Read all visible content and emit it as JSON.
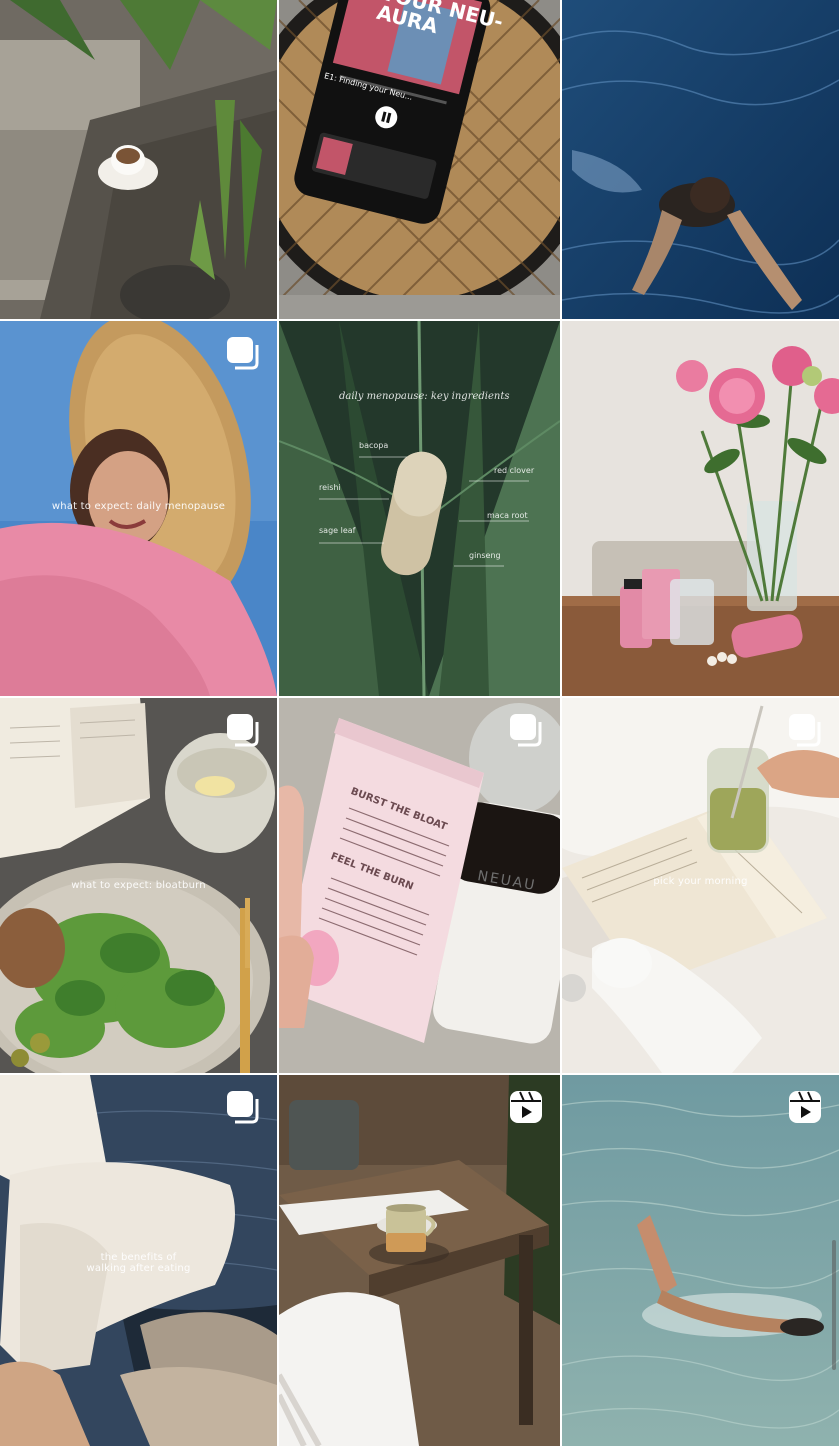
{
  "grid": {
    "posts": [
      {
        "id": "coffee",
        "caption": ""
      },
      {
        "id": "podcast",
        "caption": "",
        "phone_title": "YOUR NEU-AURA",
        "episode_title": "E1: Finding your Neu..."
      },
      {
        "id": "swimmer",
        "caption": ""
      },
      {
        "id": "straw-hat",
        "caption": "what to expect: daily menopause"
      },
      {
        "id": "capsule",
        "caption": "",
        "title_text": "daily menopause: key ingredients",
        "ingredients": [
          "bacopa",
          "red clover",
          "reishi",
          "maca root",
          "sage leaf",
          "ginseng"
        ]
      },
      {
        "id": "peonies",
        "caption": ""
      },
      {
        "id": "salad",
        "caption": "what to expect: bloatburn"
      },
      {
        "id": "bloat-box",
        "caption": "",
        "box_heading_1": "BURST THE BLOAT",
        "box_heading_2": "FEEL THE BURN",
        "bottle_label": "NEUAU"
      },
      {
        "id": "matcha",
        "caption": "pick your morning"
      },
      {
        "id": "walking",
        "caption_line1": "the benefits of",
        "caption_line2": "walking after eating"
      },
      {
        "id": "tea-table",
        "caption": ""
      },
      {
        "id": "sea-swim",
        "caption": ""
      }
    ],
    "badges": {
      "carousel": "carousel-icon",
      "reel": "reel-icon"
    }
  }
}
